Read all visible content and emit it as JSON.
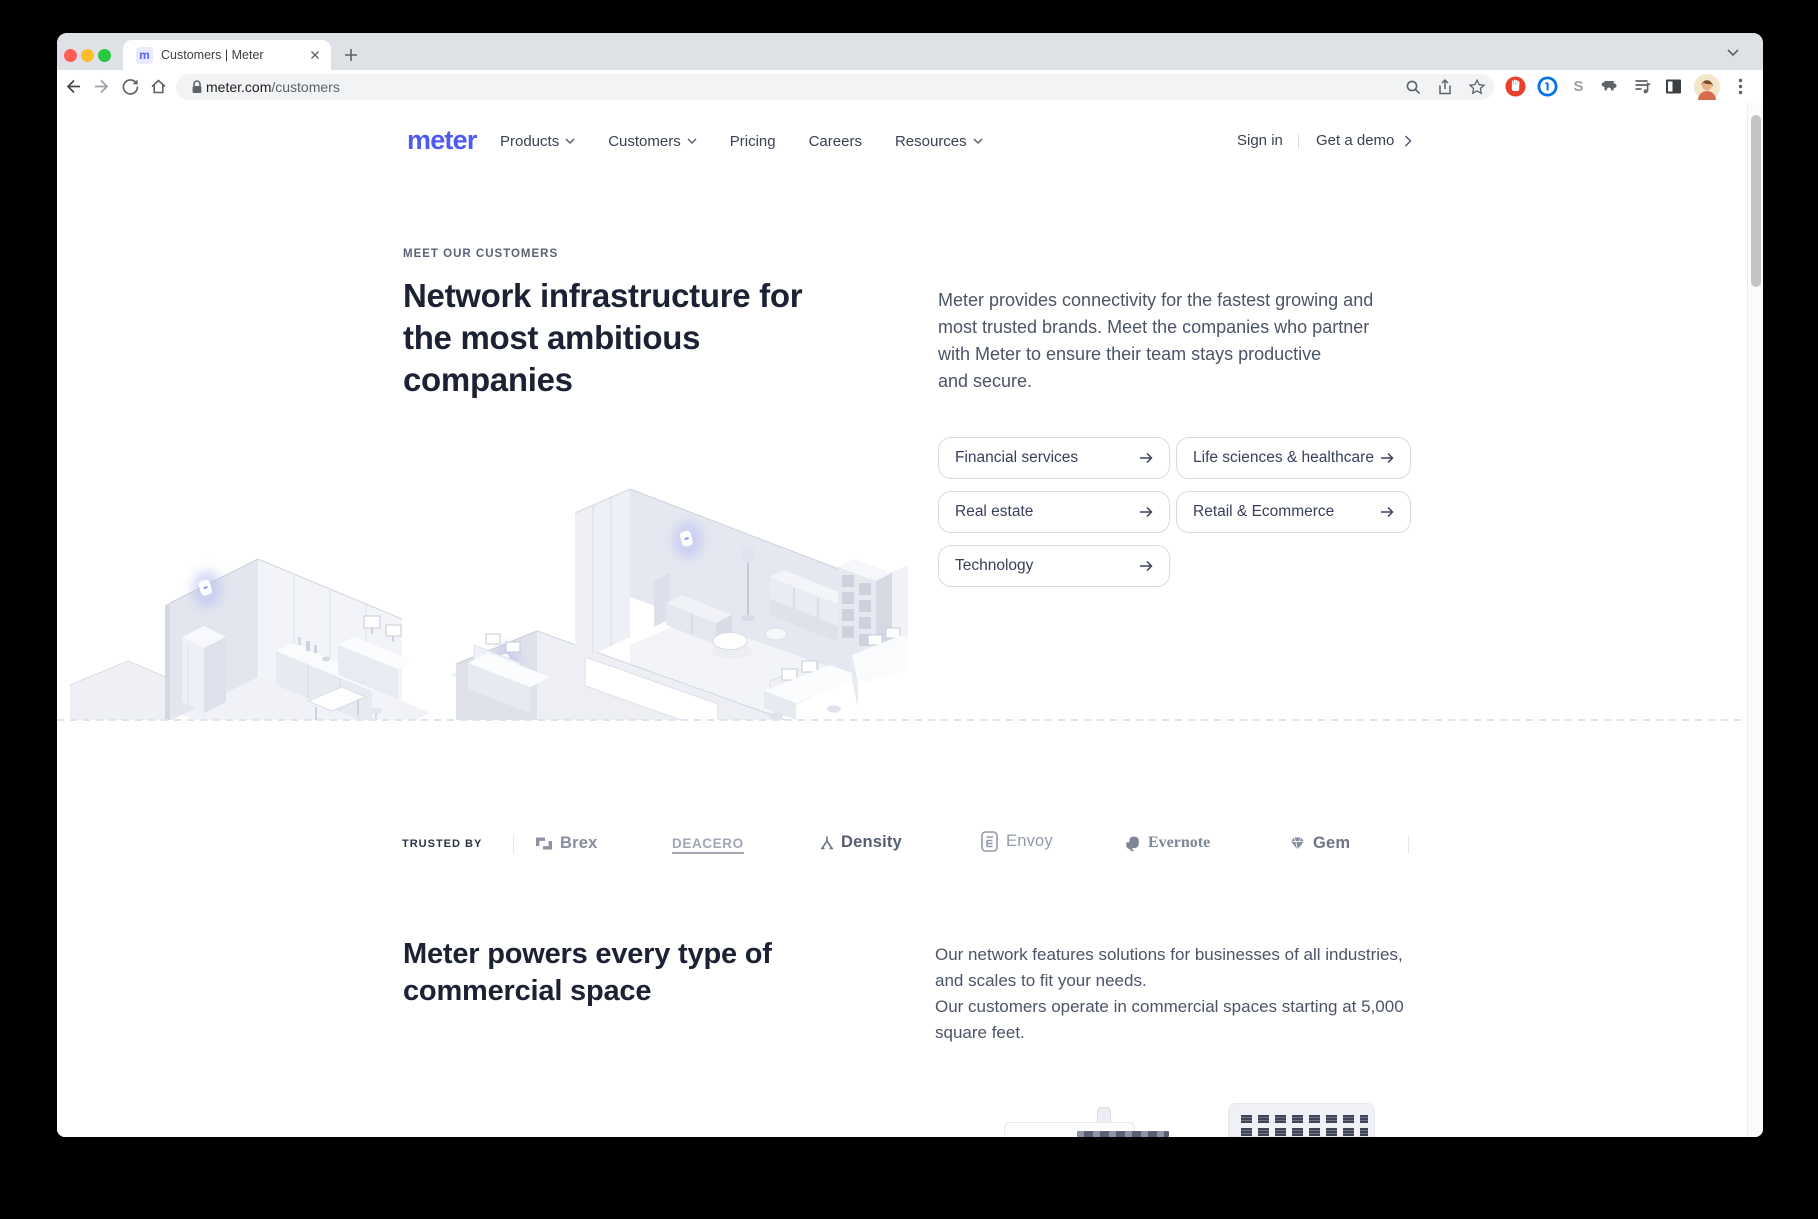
{
  "browser": {
    "tab_title": "Customers | Meter",
    "favicon_letter": "m",
    "url_domain": "meter.com",
    "url_path": "/customers",
    "extension_letter_s": "S",
    "onepassword_digit": "1"
  },
  "nav": {
    "logo": "meter",
    "items": [
      {
        "label": "Products",
        "has_dropdown": true
      },
      {
        "label": "Customers",
        "has_dropdown": true
      },
      {
        "label": "Pricing",
        "has_dropdown": false
      },
      {
        "label": "Careers",
        "has_dropdown": false
      },
      {
        "label": "Resources",
        "has_dropdown": true
      }
    ],
    "sign_in": "Sign in",
    "get_a_demo": "Get a demo"
  },
  "hero": {
    "eyebrow": "MEET OUR CUSTOMERS",
    "heading_lines": [
      "Network infrastructure for",
      "the most ambitious",
      "companies"
    ],
    "desc_lines": [
      "Meter provides connectivity for the fastest growing and",
      "most trusted brands. Meet the companies who partner",
      "with Meter to ensure their team stays productive",
      "and secure."
    ],
    "categories": [
      "Financial services",
      "Life sciences & healthcare",
      "Real estate",
      "Retail & Ecommerce",
      "Technology"
    ]
  },
  "trusted_by": {
    "label": "TRUSTED BY",
    "brands": [
      "Brex",
      "DEACERO",
      "Density",
      "Envoy",
      "Evernote",
      "Gem"
    ]
  },
  "section2": {
    "heading_lines": [
      "Meter powers every type of",
      "commercial space"
    ],
    "p1_lines": [
      "Our network features solutions for businesses of all industries,",
      "and scales to fit your needs."
    ],
    "p2_lines": [
      "Our customers operate in commercial spaces starting at 5,000",
      "square feet."
    ]
  },
  "colors": {
    "accent": "#4f5af0",
    "heading": "#1c2133",
    "body_text": "#4c5468",
    "logo_gray": "#8d93a3",
    "ap_glow": "#b7bdf1"
  }
}
